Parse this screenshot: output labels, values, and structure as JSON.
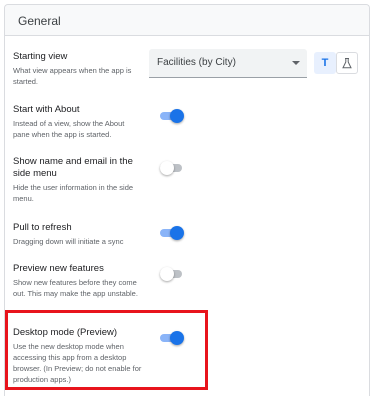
{
  "section": {
    "title": "General"
  },
  "settings": [
    {
      "title": "Starting view",
      "description": "What view appears when the app is started.",
      "control": "select",
      "value": "Facilities (by City)"
    },
    {
      "title": "Start with About",
      "description": "Instead of a view, show the About pane when the app is started.",
      "control": "toggle",
      "checked": true
    },
    {
      "title": "Show name and email in the side menu",
      "description": "Hide the user information in the side menu.",
      "control": "toggle",
      "checked": false
    },
    {
      "title": "Pull to refresh",
      "description": "Dragging down will initiate a sync",
      "control": "toggle",
      "checked": true
    },
    {
      "title": "Preview new features",
      "description": "Show new features before they come out. This may make the app unstable.",
      "control": "toggle",
      "checked": false
    },
    {
      "title": "Desktop mode (Preview)",
      "description": "Use the new desktop mode when accessing this app from a desktop browser. (In Preview; do not enable for production apps.)",
      "control": "toggle",
      "checked": true,
      "highlighted": true
    }
  ],
  "icons": {
    "view_type_text": "T",
    "view_type_lab": "flask-icon"
  },
  "colors": {
    "accent": "#1a73e8",
    "highlight": "#e8141c"
  }
}
